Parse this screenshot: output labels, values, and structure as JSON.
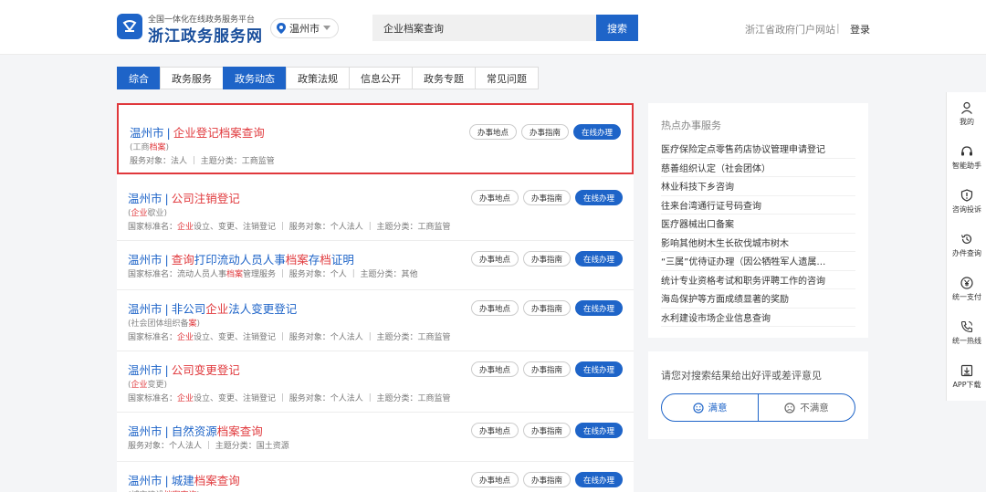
{
  "header": {
    "logo_sub": "全国一体化在线政务服务平台",
    "logo_title": "浙江政务服务网",
    "city": "温州市",
    "search_value": "企业档案查询",
    "search_button": "搜索",
    "portal_link": "浙江省政府门户网站",
    "separator": "|",
    "login": "登录"
  },
  "tabs": [
    {
      "label": "综合",
      "active": true
    },
    {
      "label": "政务服务",
      "active": false
    },
    {
      "label": "政务动态",
      "active": true
    },
    {
      "label": "政策法规",
      "active": false
    },
    {
      "label": "信息公开",
      "active": false
    },
    {
      "label": "政务专题",
      "active": false
    },
    {
      "label": "常见问题",
      "active": false
    }
  ],
  "buttons": {
    "location": "办事地点",
    "guide": "办事指南",
    "online": "在线办理"
  },
  "results": [
    {
      "city": "温州市",
      "sep": "|",
      "title": [
        [
          "企业登记",
          1
        ],
        [
          "档案查询",
          1
        ]
      ],
      "sub": [
        [
          "(工商",
          0
        ],
        [
          "档案",
          1
        ],
        [
          ")",
          0
        ]
      ],
      "meta": [
        [
          "服务对象：法人 ｜ 主题分类：工商监管",
          0
        ]
      ]
    },
    {
      "city": "温州市",
      "sep": "|",
      "title": [
        [
          "公司注销登记",
          1
        ]
      ],
      "sub": [
        [
          "(",
          0
        ],
        [
          "企业",
          1
        ],
        [
          "歇业)",
          0
        ]
      ],
      "meta": [
        [
          "国家标准名：",
          0
        ],
        [
          "企业",
          1
        ],
        [
          "设立、变更、注销登记 ｜ 服务对象：个人法人 ｜ 主题分类：工商监管",
          0
        ]
      ]
    },
    {
      "city": "温州市",
      "sep": "|",
      "title": [
        [
          "查询",
          1
        ],
        [
          "打印流动人员人事",
          0
        ],
        [
          "档案",
          1
        ],
        [
          "存",
          0
        ],
        [
          "档",
          1
        ],
        [
          "证明",
          0
        ]
      ],
      "sub": [],
      "meta": [
        [
          "国家标准名：流动人员人事",
          0
        ],
        [
          "档案",
          1
        ],
        [
          "管理服务 ｜ 服务对象：个人 ｜ 主题分类：其他",
          0
        ]
      ]
    },
    {
      "city": "温州市",
      "sep": "|",
      "title": [
        [
          "非公司",
          0
        ],
        [
          "企业",
          1
        ],
        [
          "法人变更登记",
          0
        ]
      ],
      "sub": [
        [
          "(社会团体组织备",
          0
        ],
        [
          "案",
          1
        ],
        [
          ")",
          0
        ]
      ],
      "meta": [
        [
          "国家标准名：",
          0
        ],
        [
          "企业",
          1
        ],
        [
          "设立、变更、注销登记 ｜ 服务对象：个人法人 ｜ 主题分类：工商监管",
          0
        ]
      ]
    },
    {
      "city": "温州市",
      "sep": "|",
      "title": [
        [
          "公司变更登记",
          1
        ]
      ],
      "sub": [
        [
          "(",
          0
        ],
        [
          "企业",
          1
        ],
        [
          "变更)",
          0
        ]
      ],
      "meta": [
        [
          "国家标准名：",
          0
        ],
        [
          "企业",
          1
        ],
        [
          "设立、变更、注销登记 ｜ 服务对象：个人法人 ｜ 主题分类：工商监管",
          0
        ]
      ]
    },
    {
      "city": "温州市",
      "sep": "|",
      "title": [
        [
          "自然资源",
          0
        ],
        [
          "档案查询",
          1
        ]
      ],
      "sub": [],
      "meta": [
        [
          "服务对象：个人法人 ｜ 主题分类：国土资源",
          0
        ]
      ]
    },
    {
      "city": "温州市",
      "sep": "|",
      "title": [
        [
          "城建",
          0
        ],
        [
          "档案查询",
          1
        ]
      ],
      "sub": [
        [
          "(城市建设",
          0
        ],
        [
          "档案查询",
          1
        ],
        [
          ")",
          0
        ]
      ],
      "meta": []
    }
  ],
  "hot": {
    "title": "热点办事服务",
    "items": [
      "医疗保险定点零售药店协议管理申请登记",
      "慈善组织认定（社会团体）",
      "林业科技下乡咨询",
      "往来台湾通行证号码查询",
      "医疗器械出口备案",
      "影响其他树木生长砍伐城市树木",
      "“三属”优待证办理（因公牺牲军人遗属…",
      "统计专业资格考试和职务评聘工作的咨询",
      "海岛保护等方面成绩显著的奖励",
      "水利建设市场企业信息查询"
    ]
  },
  "feedback": {
    "title": "请您对搜索结果给出好评或差评意见",
    "good": "满意",
    "bad": "不满意"
  },
  "sidebar": [
    {
      "label": "我的",
      "icon": "user-icon"
    },
    {
      "label": "智能助手",
      "icon": "headset-icon"
    },
    {
      "label": "咨询投诉",
      "icon": "shield-alert-icon"
    },
    {
      "label": "办件查询",
      "icon": "history-icon"
    },
    {
      "label": "统一支付",
      "icon": "yen-icon"
    },
    {
      "label": "统一热线",
      "icon": "phone-icon"
    },
    {
      "label": "APP下载",
      "icon": "download-icon"
    }
  ],
  "colors": {
    "brand": "#1e64c8",
    "highlight": "#e0383c"
  }
}
